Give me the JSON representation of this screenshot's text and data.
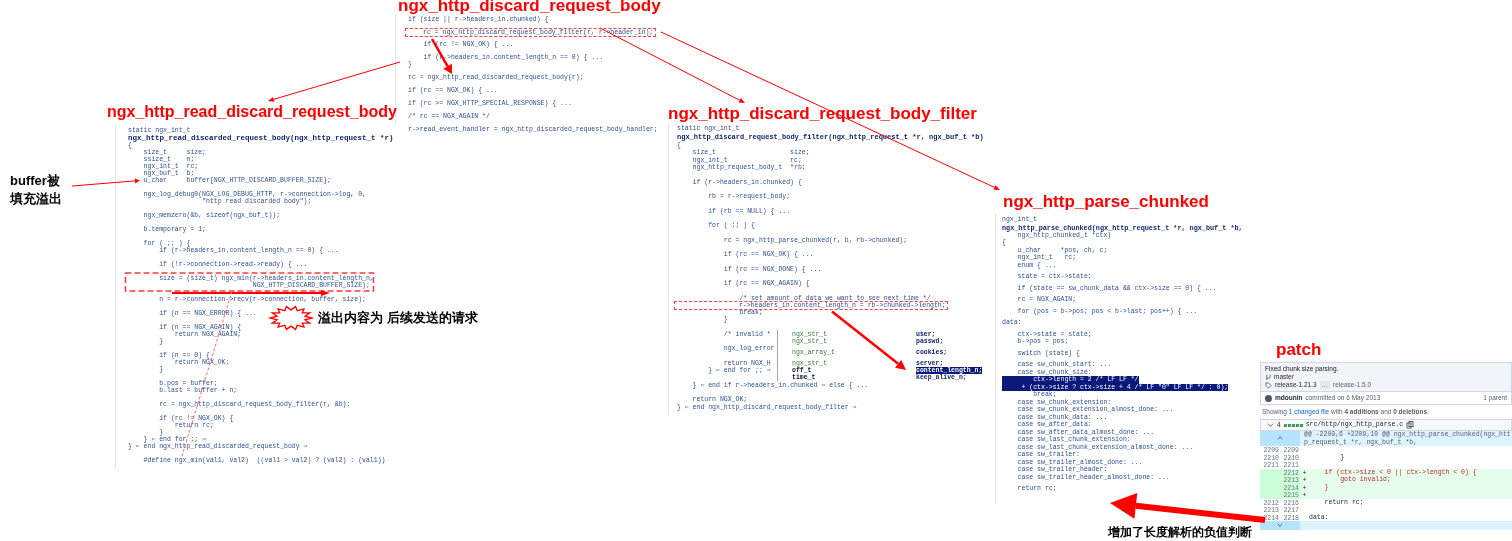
{
  "snippets": [
    {
      "title": "ngx_http_discard_request_body",
      "blocks": [
        [
          "if (size || r->headers_in.chunked) {"
        ],
        [
          "    rc = ngx_http_discard_request_body_filter(r, r->header_in);"
        ],
        [
          "    if (rc != NGX_OK) { ..."
        ],
        [
          "    if (r->headers_in.content_length_n == 0) { ...",
          "}"
        ],
        [
          "rc = ngx_http_read_discarded_request_body(r);"
        ],
        [
          "if (rc == NGX_OK) { ..."
        ],
        [
          "if (rc >= NGX_HTTP_SPECIAL_RESPONSE) { ..."
        ],
        [
          "/* rc == NGX_AGAIN */"
        ],
        [
          "r->read_event_handler = ngx_http_discarded_request_body_handler;"
        ]
      ]
    },
    {
      "title": "ngx_http_read_discard_request_body",
      "header": "static ngx_int_t",
      "signature": "ngx_http_read_discarded_request_body(ngx_http_request_t *r)",
      "blocks": [
        [
          "{",
          "    size_t     size;",
          "    ssize_t    n;",
          "    ngx_int_t  rc;",
          "    ngx_buf_t  b;",
          "    u_char     buffer[NGX_HTTP_DISCARD_BUFFER_SIZE];"
        ],
        [
          "    ngx_log_debug0(NGX_LOG_DEBUG_HTTP, r->connection->log, 0,",
          "                   \"http read discarded body\");"
        ],
        [
          "    ngx_memzero(&b, sizeof(ngx_buf_t));"
        ],
        [
          "    b.temporary = 1;"
        ],
        [
          "    for ( ;; ) {",
          "        if (r->headers_in.content_length_n == 0) { ..."
        ],
        [
          "        if (!r->connection->read->ready) { ..."
        ],
        [
          "        size = (size_t) ngx_min(r->headers_in.content_length_n,",
          "                                NGX_HTTP_DISCARD_BUFFER_SIZE);"
        ],
        [
          "        n = r->connection->recv(r->connection, buffer, size);"
        ],
        [
          "        if (n == NGX_ERROR) { ..."
        ],
        [
          "        if (n == NGX_AGAIN) {",
          "            return NGX_AGAIN;",
          "        }"
        ],
        [
          "        if (n == 0) {",
          "            return NGX_OK;",
          "        }"
        ],
        [
          "        b.pos = buffer;",
          "        b.last = buffer + n;"
        ],
        [
          "        rc = ngx_http_discard_request_body_filter(r, &b);"
        ],
        [
          "        if (rc != NGX_OK) {",
          "            return rc;",
          "        }",
          "    } ⇐ end for ;; ⇒",
          "} ⇐ end ngx_http_read_discarded_request_body ⇒"
        ],
        [
          "    #define ngx_min(val1, val2)  ((val1 > val2) ? (val2) : (val1))"
        ]
      ]
    },
    {
      "title": "ngx_http_discard_request_body_filter",
      "header": "static ngx_int_t",
      "signature": "ngx_http_discard_request_body_filter(ngx_http_request_t *r, ngx_buf_t *b)",
      "blocks": [
        [
          "{",
          "    size_t                   size;",
          "    ngx_int_t                rc;",
          "    ngx_http_request_body_t  *rb;"
        ],
        [
          "    if (r->headers_in.chunked) {"
        ],
        [
          "        rb = r->request_body;"
        ],
        [
          "        if (rb == NULL) { ..."
        ],
        [
          "        for ( ;; ) {"
        ],
        [
          "            rc = ngx_http_parse_chunked(r, b, rb->chunked);"
        ],
        [
          "            if (rc == NGX_OK) { ..."
        ],
        [
          "            if (rc == NGX_DONE) { ..."
        ],
        [
          "            if (rc == NGX_AGAIN) {"
        ],
        [
          "                /* set amount of data we want to see next time */",
          "                r->headers_in.content_length_n = rb->chunked->length;",
          "                break;",
          "            }"
        ],
        [
          "            /* invalid *"
        ],
        [
          "            ngx_log_error"
        ],
        [
          "            return NGX_H",
          "        } ⇐ end for ;; ⇒"
        ],
        [
          "    } ⇐ end if r->headers_in.chunked ⇒ else { ..."
        ],
        [
          "    return NGX_OK;",
          "} ⇐ end ngx_http_discard_request_body_filter ⇒"
        ]
      ],
      "popup": [
        [
          {
            "type": "ngx_str_t",
            "field": "user;",
            "selected": false
          },
          {
            "type": "ngx_str_t",
            "field": "passwd;",
            "selected": false
          }
        ],
        [
          {
            "type": "ngx_array_t",
            "field": "cookies;",
            "selected": false
          }
        ],
        [
          {
            "type": "ngx_str_t",
            "field": "server;",
            "selected": false
          },
          {
            "type": "off_t",
            "field": "content_length_n;",
            "selected": true
          },
          {
            "type": "time_t",
            "field": "keep_alive_n;",
            "selected": false
          }
        ]
      ]
    },
    {
      "title": "ngx_http_parse_chunked",
      "header": "ngx_int_t",
      "signature": "ngx_http_parse_chunked(ngx_http_request_t *r, ngx_buf_t *b,",
      "blocks": [
        [
          {
            "text": "    ngx_http_chunked_t *ctx)",
            "highlighted": false
          },
          {
            "text": "{",
            "highlighted": false
          },
          {
            "text": "    u_char     *pos, ch, c;",
            "highlighted": false
          },
          {
            "text": "    ngx_int_t   rc;",
            "highlighted": false
          },
          {
            "text": "    enum { ...",
            "highlighted": false
          }
        ],
        [
          {
            "text": "    state = ctx->state;",
            "highlighted": false
          }
        ],
        [
          {
            "text": "    if (state == sw_chunk_data && ctx->size == 0) { ...",
            "highlighted": false
          }
        ],
        [
          {
            "text": "    rc = NGX_AGAIN;",
            "highlighted": false
          }
        ],
        [
          {
            "text": "    for (pos = b->pos; pos < b->last; pos++) { ...",
            "highlighted": false
          }
        ],
        [
          {
            "text": "data:",
            "highlighted": false
          }
        ],
        [
          {
            "text": "    ctx->state = state;",
            "highlighted": false
          },
          {
            "text": "    b->pos = pos;",
            "highlighted": false
          }
        ],
        [
          {
            "text": "    switch (state) {",
            "highlighted": false
          }
        ],
        [
          {
            "text": "    case sw_chunk_start: ...",
            "highlighted": false
          },
          {
            "text": "    case sw_chunk_size:",
            "highlighted": false
          },
          {
            "text": "        ctx->length = 2 /* LF LF */",
            "highlighted": true
          },
          {
            "text": "     + (ctx->size ? ctx->size + 4 /* LF \"0\" LF LF */ : 0);",
            "highlighted": true
          },
          {
            "text": "        break;",
            "highlighted": false
          },
          {
            "text": "    case sw_chunk_extension:",
            "highlighted": false
          },
          {
            "text": "    case sw_chunk_extension_almost_done: ...",
            "highlighted": false
          },
          {
            "text": "    case sw_chunk_data: ...",
            "highlighted": false
          },
          {
            "text": "    case sw_after_data:",
            "highlighted": false
          },
          {
            "text": "    case sw_after_data_almost_done: ...",
            "highlighted": false
          },
          {
            "text": "    case sw_last_chunk_extension:",
            "highlighted": false
          },
          {
            "text": "    case sw_last_chunk_extension_almost_done: ...",
            "highlighted": false
          },
          {
            "text": "    case sw_trailer:",
            "highlighted": false
          },
          {
            "text": "    case sw_trailer_almost_done: ...",
            "highlighted": false
          },
          {
            "text": "    case sw_trailer_header:",
            "highlighted": false
          },
          {
            "text": "    case sw_trailer_header_almost_done: ...",
            "highlighted": false
          }
        ],
        [
          {
            "text": "    return rc;",
            "highlighted": false
          }
        ]
      ]
    }
  ],
  "notes": [
    "buffer被",
    "填充溢出",
    "溢出内容为 后续发送的请求",
    "增加了长度解析的负值判断"
  ],
  "patch": {
    "title": "patch",
    "commit_message": "Fixed chunk size parsing.",
    "branch": "master",
    "tag_newest": "release-1.21.3",
    "tag_separator": "…",
    "tag_oldest": "release-1.5.0",
    "author": "mdounin",
    "committed": "committed on 6 May 2013",
    "parents": "1 parent",
    "summary": {
      "before": "Showing ",
      "link": "1 changed file",
      "after": " with **4 additions** and **0 deletions**."
    },
    "file": {
      "count": "4",
      "path": "src/http/ngx_http_parse.c"
    },
    "hunk": "@@ -2209,6 +2209,10 @@ ngx_http_parse_chunked(ngx_http_request_t *r, ngx_buf_t *b,",
    "rows": [
      {
        "kind": "context",
        "old": "2209",
        "new": "2209"
      },
      {
        "kind": "context",
        "old": "2210",
        "new": "2210",
        "text": "        }"
      },
      {
        "kind": "context",
        "old": "2211",
        "new": "2211"
      },
      {
        "kind": "added",
        "new": "2212",
        "sign": "+",
        "text": "    if (ctx->size < 0 || ctx->length < 0) {"
      },
      {
        "kind": "added",
        "new": "2213",
        "sign": "+",
        "text": "        goto invalid;"
      },
      {
        "kind": "added",
        "new": "2214",
        "sign": "+",
        "text": "    }"
      },
      {
        "kind": "added",
        "new": "2215",
        "sign": "+"
      },
      {
        "kind": "context",
        "old": "2212",
        "new": "2216",
        "text": "    return rc;"
      },
      {
        "kind": "context",
        "old": "2213",
        "new": "2217"
      },
      {
        "kind": "context",
        "old": "2214",
        "new": "2218",
        "text": "data:"
      }
    ]
  }
}
